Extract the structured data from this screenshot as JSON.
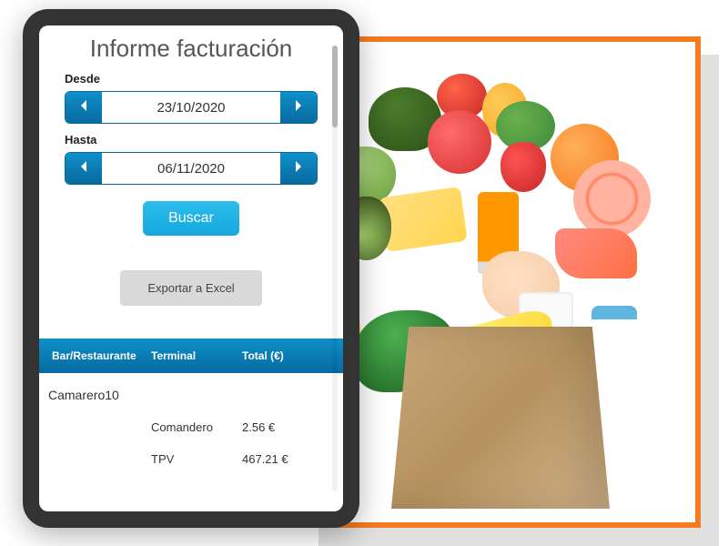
{
  "title": "Informe facturación",
  "fields": {
    "desde": {
      "label": "Desde",
      "value": "23/10/2020"
    },
    "hasta": {
      "label": "Hasta",
      "value": "06/11/2020"
    }
  },
  "buttons": {
    "search": "Buscar",
    "export": "Exportar a Excel"
  },
  "table": {
    "headers": {
      "bar": "Bar/Restaurante",
      "terminal": "Terminal",
      "total": "Total (€)"
    },
    "group": "Camarero10",
    "rows": [
      {
        "terminal": "Comandero",
        "total": "2.56 €"
      },
      {
        "terminal": "TPV",
        "total": "467.21 €"
      }
    ]
  }
}
